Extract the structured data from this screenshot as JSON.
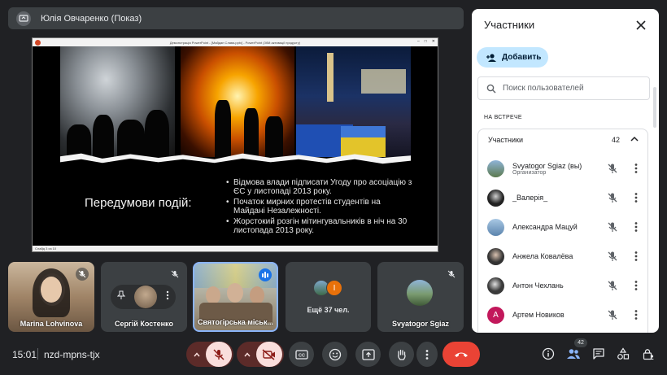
{
  "presenter": {
    "name": "Юлія Овчаренко (Показ)"
  },
  "ppt": {
    "window_title": "Демонстрація PowerPoint - [Майдан Слава.pptx] - PowerPoint (Збій активації продукту)",
    "status": "Слайд 3 из 10"
  },
  "slide": {
    "heading": "Передумови подій:",
    "bullets": [
      "Відмова влади підписати Угоду про асоціацію з ЄС у листопаді 2013 року.",
      "Початок мирних протестів студентів на Майдані Незалежності.",
      "Жорстокий розгін мітингувальників в ніч на 30 листопада 2013 року."
    ]
  },
  "tiles": [
    {
      "name": "Marina Lohvinova"
    },
    {
      "name": "Сергій Костенко"
    },
    {
      "name": "Святогірська міськ..."
    },
    {
      "name": "Ещё 37 чел.",
      "initial": "I"
    },
    {
      "name": "Svyatogor Sgiaz"
    }
  ],
  "panel": {
    "title": "Участники",
    "add_label": "Добавить",
    "search_placeholder": "Поиск пользователей",
    "section_label": "НА ВСТРЕЧЕ",
    "group_label": "Участники",
    "group_count": "42",
    "participants": [
      {
        "name": "Svyatogor Sgiaz (вы)",
        "role": "Организатор",
        "avatar_color": "#6b8fb0"
      },
      {
        "name": "_Валерія_",
        "role": "",
        "avatar_color": "#2b2b2b"
      },
      {
        "name": "Александра Мацуй",
        "role": "",
        "avatar_color": "#7fa3c7"
      },
      {
        "name": "Анжела Ковалёва",
        "role": "",
        "avatar_color": "#3a3a3a"
      },
      {
        "name": "Антон Чехлань",
        "role": "",
        "avatar_color": "#4a4a4a"
      },
      {
        "name": "Артем Новиков",
        "role": "",
        "avatar_color": "#c2185b",
        "initial": "А"
      }
    ]
  },
  "bottom": {
    "time": "15:01",
    "meeting_code": "nzd-mpns-tjx",
    "people_badge": "42"
  },
  "colors": {
    "background": "#202124",
    "accent_blue": "#8ab4f8",
    "hangup_red": "#ea4335",
    "muted_pink": "#f9dedc"
  }
}
